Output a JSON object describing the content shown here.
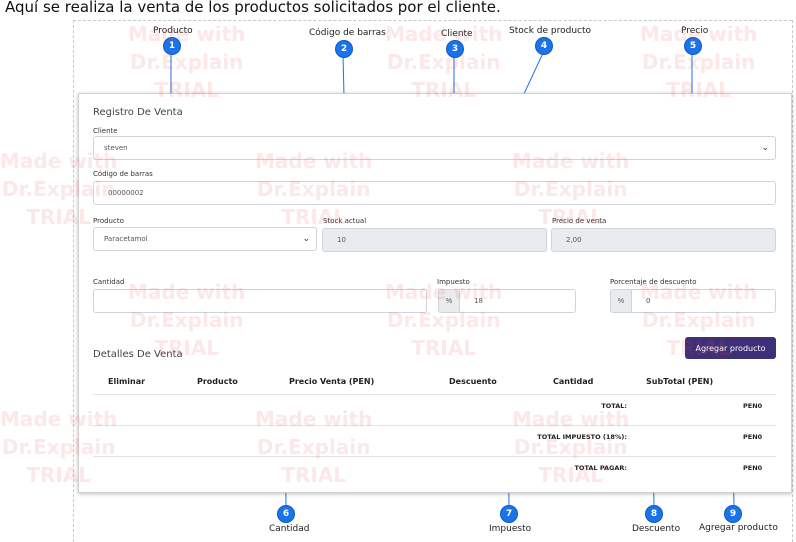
{
  "intro_text": "Aquí se realiza la venta de los productos solicitados por el cliente.",
  "callouts": [
    {
      "num": "1",
      "label": "Producto"
    },
    {
      "num": "2",
      "label": "Código de barras"
    },
    {
      "num": "3",
      "label": "Cliente"
    },
    {
      "num": "4",
      "label": "Stock de producto"
    },
    {
      "num": "5",
      "label": "Precio"
    },
    {
      "num": "6",
      "label": "Cantidad"
    },
    {
      "num": "7",
      "label": "Impuesto"
    },
    {
      "num": "8",
      "label": "Descuento"
    },
    {
      "num": "9",
      "label": "Agregar producto"
    }
  ],
  "form": {
    "title": "Registro De Venta",
    "cliente_label": "Cliente",
    "cliente_value": "steven",
    "barcode_label": "Código de barras",
    "barcode_value": "00000002",
    "producto_label": "Producto",
    "producto_value": "Paracetamol",
    "stock_label": "Stock actual",
    "stock_value": "10",
    "precio_label": "Precio de venta",
    "precio_value": "2,00",
    "cantidad_label": "Cantidad",
    "cantidad_value": "",
    "impuesto_label": "Impuesto",
    "impuesto_addon": "%",
    "impuesto_value": "18",
    "descuento_label": "Porcentaje de descuento",
    "descuento_addon": "%",
    "descuento_value": "0"
  },
  "details": {
    "title": "Detalles De Venta",
    "add_button": "Agregar producto",
    "columns": [
      "Eliminar",
      "Producto",
      "Precio Venta (PEN)",
      "Descuento",
      "Cantidad",
      "SubTotal (PEN)"
    ],
    "totals": [
      {
        "label": "TOTAL:",
        "value": "PEN0"
      },
      {
        "label": "TOTAL IMPUESTO (18%):",
        "value": "PEN0"
      },
      {
        "label": "TOTAL PAGAR:",
        "value": "PEN0"
      }
    ]
  },
  "watermark_text": "Made with\nDr.Explain\nTRIAL",
  "colors": {
    "marker": "#1a73e8",
    "button": "#3d2f78",
    "readonly": "#e9ecef"
  }
}
